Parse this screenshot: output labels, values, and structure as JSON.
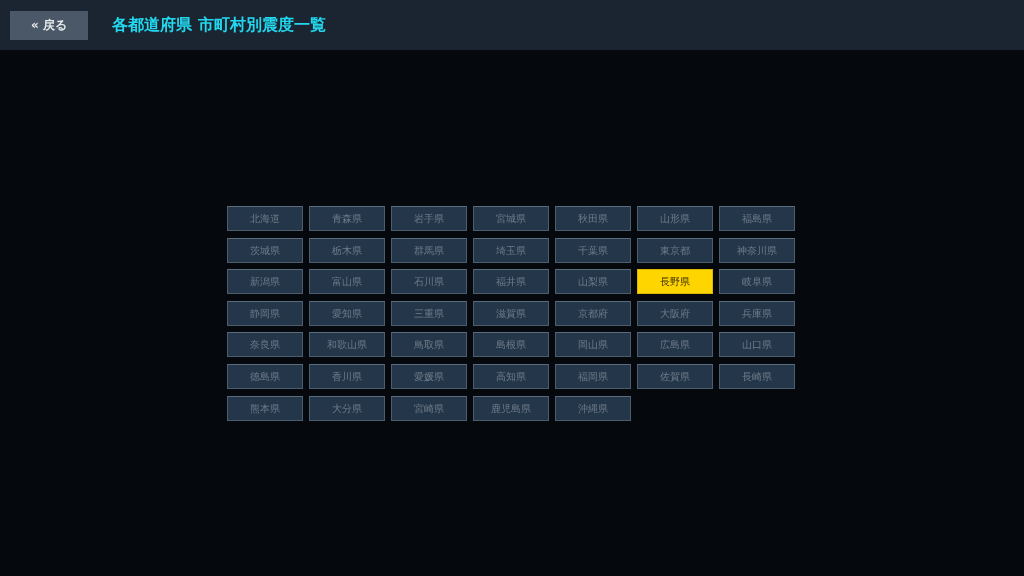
{
  "header": {
    "back_button": "« 戻る",
    "title": "各都道府県 市町村別震度一覧"
  },
  "prefectures": [
    {
      "label": "北海道",
      "selected": false
    },
    {
      "label": "青森県",
      "selected": false
    },
    {
      "label": "岩手県",
      "selected": false
    },
    {
      "label": "宮城県",
      "selected": false
    },
    {
      "label": "秋田県",
      "selected": false
    },
    {
      "label": "山形県",
      "selected": false
    },
    {
      "label": "福島県",
      "selected": false
    },
    {
      "label": "茨城県",
      "selected": false
    },
    {
      "label": "栃木県",
      "selected": false
    },
    {
      "label": "群馬県",
      "selected": false
    },
    {
      "label": "埼玉県",
      "selected": false
    },
    {
      "label": "千葉県",
      "selected": false
    },
    {
      "label": "東京都",
      "selected": false
    },
    {
      "label": "神奈川県",
      "selected": false
    },
    {
      "label": "新潟県",
      "selected": false
    },
    {
      "label": "富山県",
      "selected": false
    },
    {
      "label": "石川県",
      "selected": false
    },
    {
      "label": "福井県",
      "selected": false
    },
    {
      "label": "山梨県",
      "selected": false
    },
    {
      "label": "長野県",
      "selected": true
    },
    {
      "label": "岐阜県",
      "selected": false
    },
    {
      "label": "静岡県",
      "selected": false
    },
    {
      "label": "愛知県",
      "selected": false
    },
    {
      "label": "三重県",
      "selected": false
    },
    {
      "label": "滋賀県",
      "selected": false
    },
    {
      "label": "京都府",
      "selected": false
    },
    {
      "label": "大阪府",
      "selected": false
    },
    {
      "label": "兵庫県",
      "selected": false
    },
    {
      "label": "奈良県",
      "selected": false
    },
    {
      "label": "和歌山県",
      "selected": false
    },
    {
      "label": "鳥取県",
      "selected": false
    },
    {
      "label": "島根県",
      "selected": false
    },
    {
      "label": "岡山県",
      "selected": false
    },
    {
      "label": "広島県",
      "selected": false
    },
    {
      "label": "山口県",
      "selected": false
    },
    {
      "label": "徳島県",
      "selected": false
    },
    {
      "label": "香川県",
      "selected": false
    },
    {
      "label": "愛媛県",
      "selected": false
    },
    {
      "label": "高知県",
      "selected": false
    },
    {
      "label": "福岡県",
      "selected": false
    },
    {
      "label": "佐賀県",
      "selected": false
    },
    {
      "label": "長崎県",
      "selected": false
    },
    {
      "label": "熊本県",
      "selected": false
    },
    {
      "label": "大分県",
      "selected": false
    },
    {
      "label": "宮崎県",
      "selected": false
    },
    {
      "label": "鹿児島県",
      "selected": false
    },
    {
      "label": "沖縄県",
      "selected": false
    }
  ]
}
